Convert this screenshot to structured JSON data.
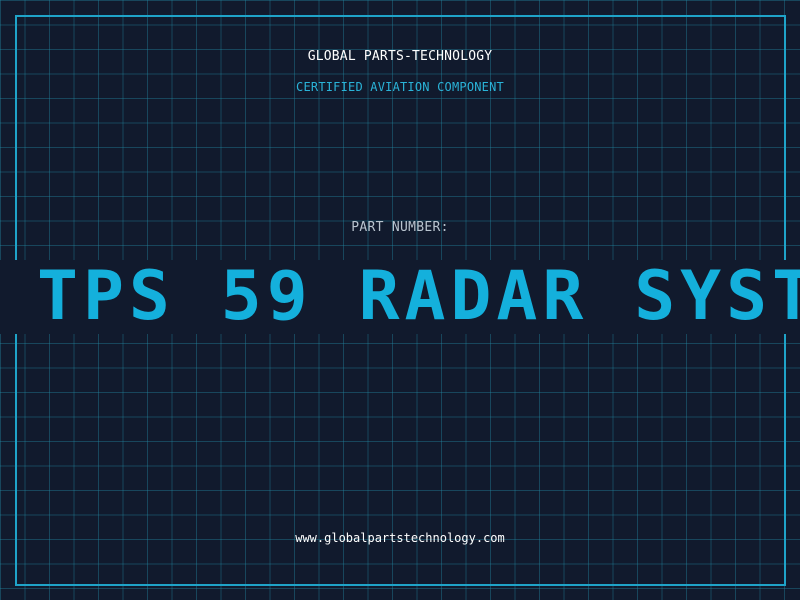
{
  "header": {
    "company": "GLOBAL PARTS-TECHNOLOGY",
    "subtitle": "CERTIFIED AVIATION COMPONENT"
  },
  "part": {
    "label": "PART NUMBER:",
    "number": "TPS 59 RADAR SYST"
  },
  "footer": {
    "url": "www.globalpartstechnology.com"
  },
  "colors": {
    "background": "#111a2d",
    "grid": "#1b6f88",
    "accent": "#14b0dc",
    "frame": "#1fa3c8",
    "text": "#ffffff",
    "muted": "#b9c4cf"
  }
}
